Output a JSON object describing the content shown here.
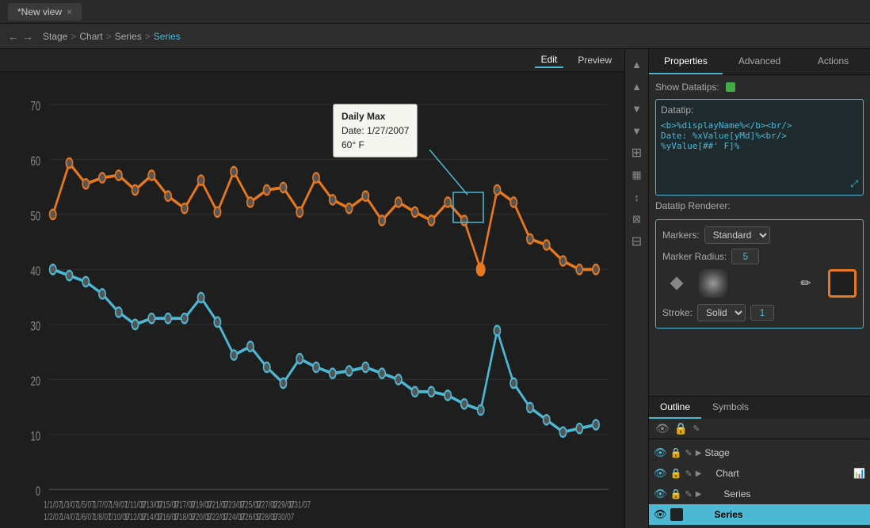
{
  "topbar": {
    "tab_label": "*New view",
    "close": "×"
  },
  "breadcrumb": {
    "back": "←",
    "forward": "→",
    "items": [
      "Stage",
      "Chart",
      "Series",
      "Series"
    ],
    "separators": [
      ">",
      ">",
      ">"
    ],
    "active_index": 3
  },
  "chart_toolbar": {
    "edit_label": "Edit",
    "preview_label": "Preview"
  },
  "tooltip": {
    "title": "Daily Max",
    "date_label": "Date:",
    "date_value": "1/27/2007",
    "value": "60° F"
  },
  "y_axis": {
    "labels": [
      "0",
      "10",
      "20",
      "30",
      "40",
      "50",
      "60",
      "70"
    ]
  },
  "properties": {
    "tab_properties": "Properties",
    "tab_advanced": "Advanced",
    "tab_actions": "Actions",
    "show_datatips_label": "Show Datatips:",
    "datatip_label": "Datatip:",
    "datatip_value": "<b>%displayName%</b><br/>\nDate: %xValue[yMd]%<br/>\n%yValue[##' F]%",
    "datatip_renderer_label": "Datatip Renderer:",
    "markers_label": "Markers:",
    "markers_value": "Standard",
    "marker_radius_label": "Marker Radius:",
    "marker_radius_value": "5",
    "stroke_label": "Stroke:",
    "stroke_value": "Solid",
    "stroke_num": "1"
  },
  "outline": {
    "tab_outline": "Outline",
    "tab_symbols": "Symbols",
    "rows": [
      {
        "label": "Stage",
        "indent": 0,
        "has_arrow": true,
        "icons": [
          "eye",
          "lock",
          "edit"
        ]
      },
      {
        "label": "Chart",
        "indent": 1,
        "has_arrow": true,
        "icons": [
          "eye",
          "lock",
          "edit"
        ],
        "has_chart_icon": true
      },
      {
        "label": "Series",
        "indent": 2,
        "has_arrow": true,
        "icons": [
          "eye",
          "lock",
          "edit"
        ]
      },
      {
        "label": "Series",
        "indent": 3,
        "icons": [
          "eye",
          "dark_block"
        ],
        "selected": true
      }
    ]
  },
  "side_tools": [
    "▲",
    "▲",
    "▼",
    "▼",
    "⊕",
    "▦",
    "↕",
    "⊠",
    "⊞"
  ]
}
